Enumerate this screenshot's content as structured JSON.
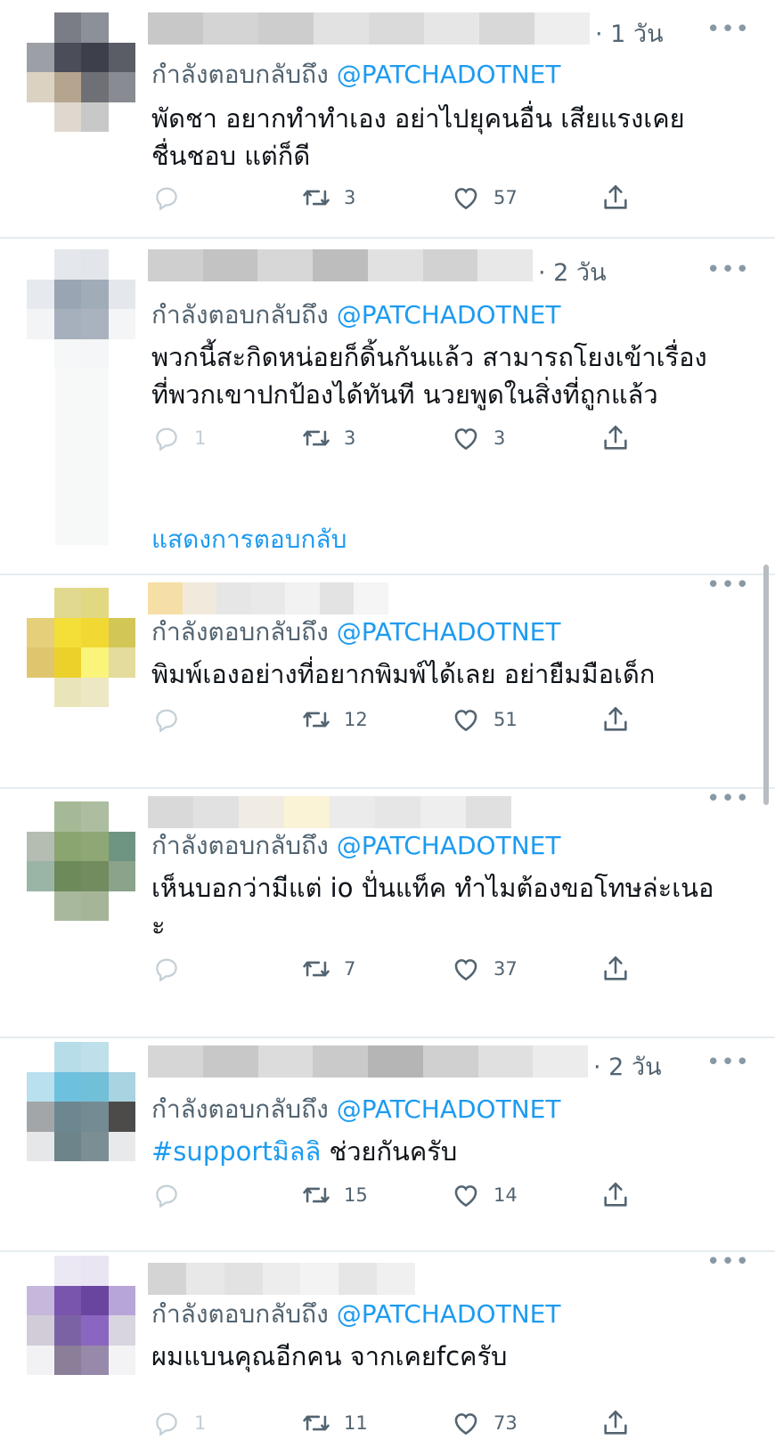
{
  "colors": {
    "accent": "#1d9bf0",
    "muted": "#536471",
    "text": "#0f1419",
    "divider": "#e6ecf0"
  },
  "icons": {
    "reply": "reply-bubble-icon",
    "retweet": "retweet-icon",
    "like": "heart-icon",
    "share": "share-icon",
    "more": "more-dots-icon"
  },
  "show_replies_label": "แสดงการตอบกลับ",
  "tweets": [
    {
      "time": "· 1 วัน",
      "more": "•••",
      "replying_prefix": "กำลังตอบกลับถึง",
      "replying_handle": "@PATCHADOTNET",
      "text_line1": "พัดชา อยากทำทำเอง อย่าไปยุคนอื่น   เสียแรงเคย",
      "text_line2": "ชื่นชอบ แต่ก็ดี",
      "replies": "",
      "retweets": "3",
      "likes": "57"
    },
    {
      "time": "· 2 วัน",
      "more": "•••",
      "replying_prefix": "กำลังตอบกลับถึง",
      "replying_handle": "@PATCHADOTNET",
      "text_line1": "พวกนี้สะกิดหน่อยก็ดิ้นกันแล้ว สามารถโยงเข้าเรื่อง",
      "text_line2": "ที่พวกเขาปกป้องได้ทันที นวยพูดในสิ่งที่ถูกแล้ว",
      "replies": "1",
      "retweets": "3",
      "likes": "3"
    },
    {
      "time": "",
      "more": "•••",
      "replying_prefix": "กำลังตอบกลับถึง",
      "replying_handle": "@PATCHADOTNET",
      "text_line1": "พิมพ์เองอย่างที่อยากพิมพ์ได้เลย อย่ายืมมือเด็ก",
      "text_line2": "",
      "replies": "",
      "retweets": "12",
      "likes": "51"
    },
    {
      "time": "",
      "more": "•••",
      "replying_prefix": "กำลังตอบกลับถึง",
      "replying_handle": "@PATCHADOTNET",
      "text_line1": "เห็นบอกว่ามีแต่ io ปั่นแท็ค ทำไมต้องขอโทษล่ะเนอ",
      "text_line2": "ะ",
      "replies": "",
      "retweets": "7",
      "likes": "37"
    },
    {
      "time": "· 2 วัน",
      "more": "•••",
      "replying_prefix": "กำลังตอบกลับถึง",
      "replying_handle": "@PATCHADOTNET",
      "hashtag": "#supportมิลลิ",
      "text_line1": " ช่วยกันครับ",
      "text_line2": "",
      "replies": "",
      "retweets": "15",
      "likes": "14"
    },
    {
      "time": "",
      "more": "•••",
      "replying_prefix": "กำลังตอบกลับถึง",
      "replying_handle": "@PATCHADOTNET",
      "text_line1": "ผมแบนคุณอีกคน จากเคยfcครับ",
      "text_line2": "",
      "replies": "1",
      "retweets": "11",
      "likes": "73"
    }
  ]
}
